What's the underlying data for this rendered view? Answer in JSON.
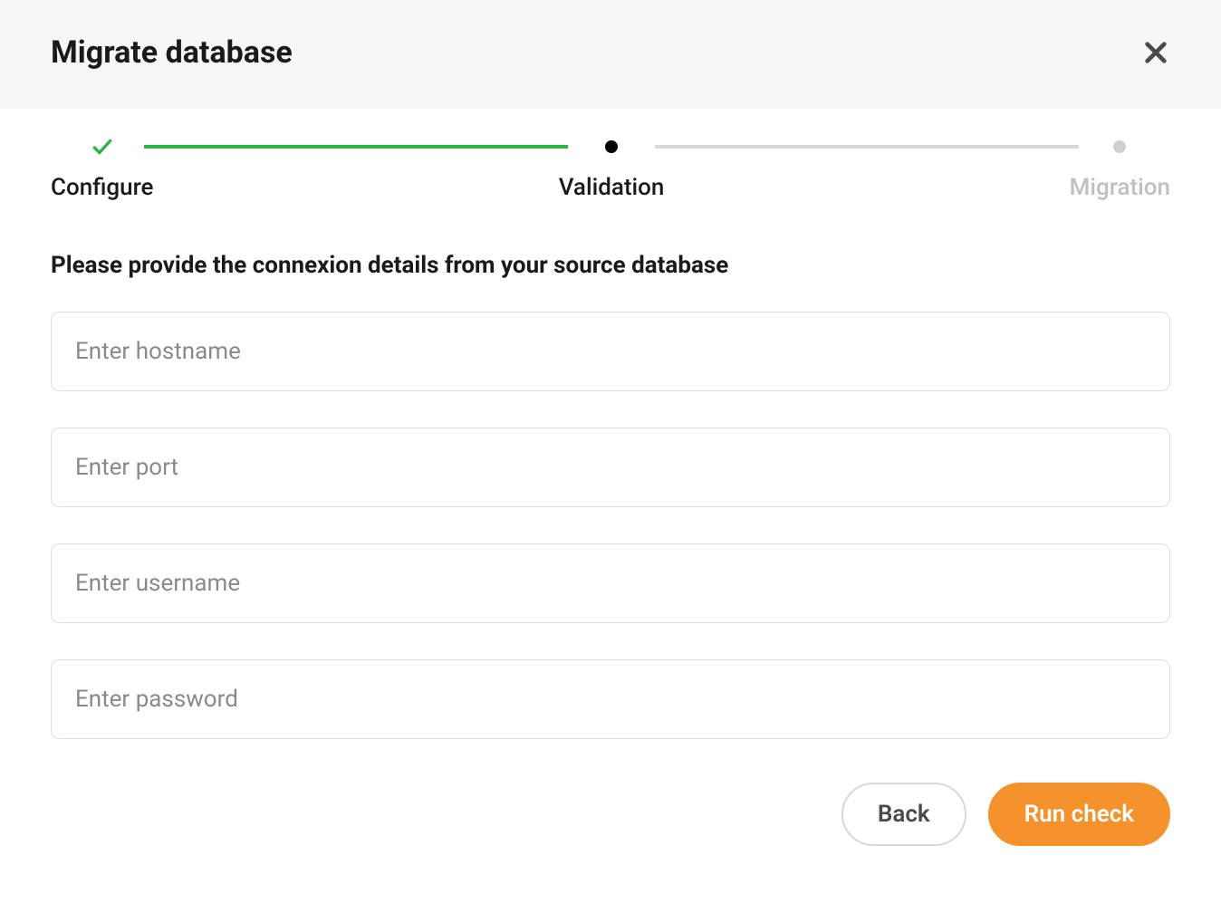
{
  "header": {
    "title": "Migrate database"
  },
  "stepper": {
    "steps": [
      {
        "label": "Configure",
        "state": "done"
      },
      {
        "label": "Validation",
        "state": "current"
      },
      {
        "label": "Migration",
        "state": "pending"
      }
    ]
  },
  "form": {
    "instruction": "Please provide the connexion details from your source database",
    "fields": {
      "hostname": {
        "placeholder": "Enter hostname",
        "value": ""
      },
      "port": {
        "placeholder": "Enter port",
        "value": ""
      },
      "username": {
        "placeholder": "Enter username",
        "value": ""
      },
      "password": {
        "placeholder": "Enter password",
        "value": ""
      }
    }
  },
  "actions": {
    "back_label": "Back",
    "run_check_label": "Run check"
  },
  "colors": {
    "accent_green": "#2fb344",
    "accent_orange": "#f5922b",
    "pending_grey": "#d0d0d0"
  }
}
